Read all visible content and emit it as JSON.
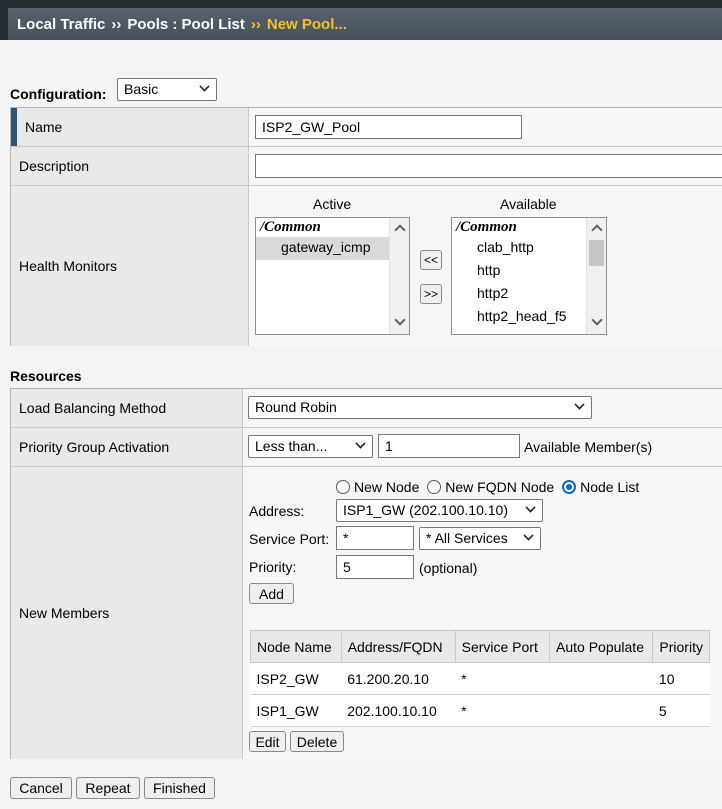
{
  "breadcrumb": {
    "section": "Local Traffic",
    "separator": "››",
    "parent": "Pools : Pool List",
    "current": "New Pool..."
  },
  "configuration": {
    "label": "Configuration:",
    "mode": "Basic"
  },
  "general": {
    "name_label": "Name",
    "name_value": "ISP2_GW_Pool",
    "description_label": "Description",
    "description_value": "",
    "health_label": "Health Monitors",
    "active_heading": "Active",
    "available_heading": "Available",
    "active_list": {
      "folder": "/Common",
      "items": [
        "gateway_icmp"
      ]
    },
    "available_list": {
      "folder": "/Common",
      "items": [
        "clab_http",
        "http",
        "http2",
        "http2_head_f5"
      ]
    },
    "move_left": "<<",
    "move_right": ">>"
  },
  "resources": {
    "heading": "Resources",
    "lb_label": "Load Balancing Method",
    "lb_value": "Round Robin",
    "pga_label": "Priority Group Activation",
    "pga_mode": "Less than...",
    "pga_count": "1",
    "pga_suffix": "Available Member(s)",
    "members_label": "New Members",
    "radio_new_node": "New Node",
    "radio_new_fqdn": "New FQDN Node",
    "radio_node_list": "Node List",
    "address_label": "Address:",
    "address_value": "ISP1_GW (202.100.10.10)",
    "port_label": "Service Port:",
    "port_value": "*",
    "port_service": "* All Services",
    "priority_label": "Priority:",
    "priority_value": "5",
    "priority_hint": "(optional)",
    "add_button": "Add",
    "columns": [
      "Node Name",
      "Address/FQDN",
      "Service Port",
      "Auto Populate",
      "Priority"
    ],
    "rows": [
      {
        "node": "ISP2_GW",
        "address": "61.200.20.10",
        "port": "*",
        "auto": "",
        "priority": "10"
      },
      {
        "node": "ISP1_GW",
        "address": "202.100.10.10",
        "port": "*",
        "auto": "",
        "priority": "5"
      }
    ],
    "edit_button": "Edit",
    "delete_button": "Delete"
  },
  "footer": {
    "cancel": "Cancel",
    "repeat": "Repeat",
    "finished": "Finished"
  }
}
